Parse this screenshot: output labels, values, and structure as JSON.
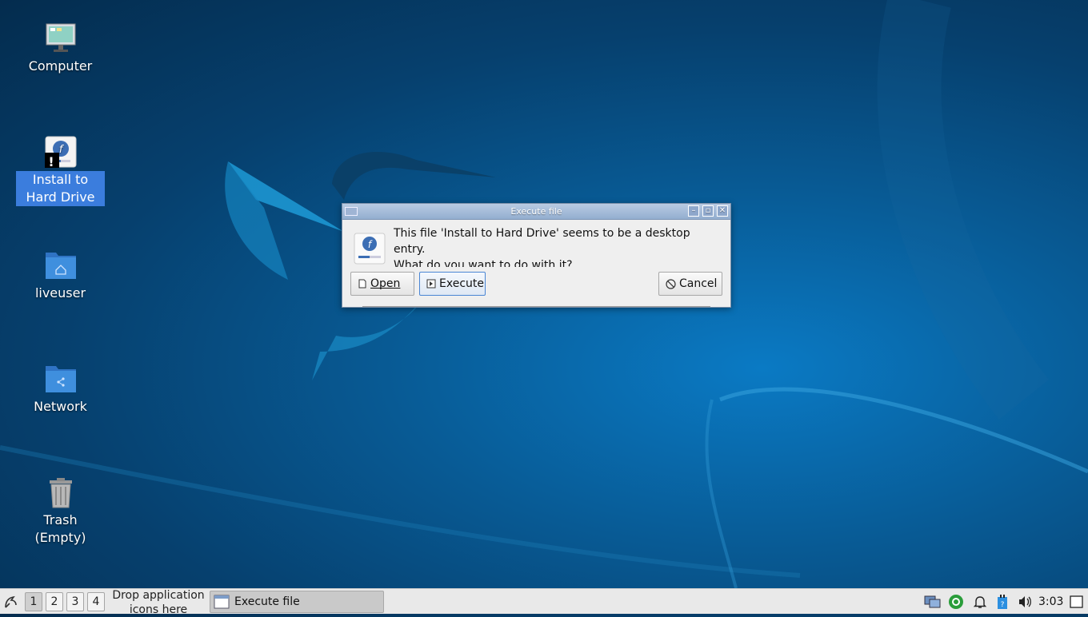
{
  "desktop": {
    "icons": [
      {
        "label": "Computer"
      },
      {
        "label": "Install to Hard Drive"
      },
      {
        "label": "liveuser"
      },
      {
        "label": "Network"
      },
      {
        "label": "Trash (Empty)"
      }
    ]
  },
  "dialog": {
    "title": "Execute file",
    "message_line1": "This file 'Install to Hard Drive' seems to be a desktop entry.",
    "message_line2": "What do you want to do with it?",
    "open_label": "Open",
    "execute_label": "Execute",
    "cancel_label": "Cancel"
  },
  "taskbar": {
    "workspaces": [
      "1",
      "2",
      "3",
      "4"
    ],
    "active_workspace": "1",
    "drop_hint": "Drop application icons here",
    "task_label": "Execute file",
    "clock": "3:03"
  },
  "colors": {
    "selection": "#3b7ddd",
    "desktop_bg": "#085a94",
    "folder": "#3f8fde"
  }
}
